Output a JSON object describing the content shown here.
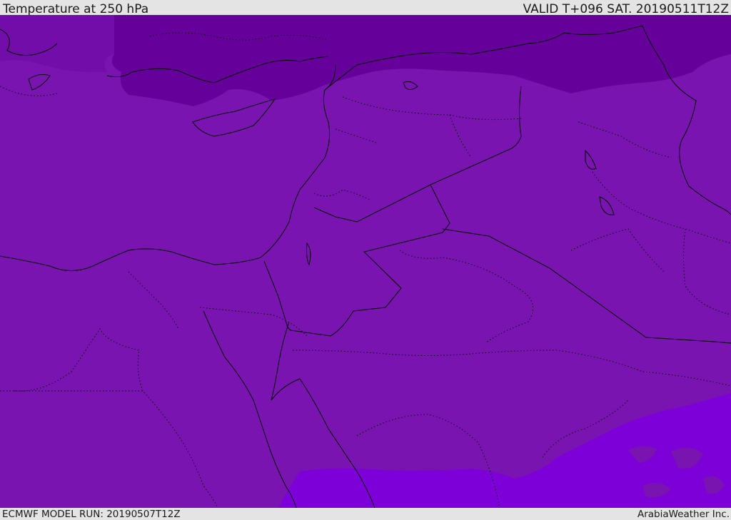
{
  "header": {
    "title": "Temperature at 250 hPa",
    "valid_time": "VALID T+096 SAT. 20190511T12Z"
  },
  "footer": {
    "model_run": "ECMWF MODEL RUN: 20190507T12Z",
    "credit": "ArabiaWeather Inc."
  },
  "colors": {
    "background": "#e4e4e4",
    "base_temperature_fill": "#7a14b0",
    "cold_band_fill": "#65009a",
    "warm_band_fill": "#7d00d8",
    "borders": "#000000"
  }
}
